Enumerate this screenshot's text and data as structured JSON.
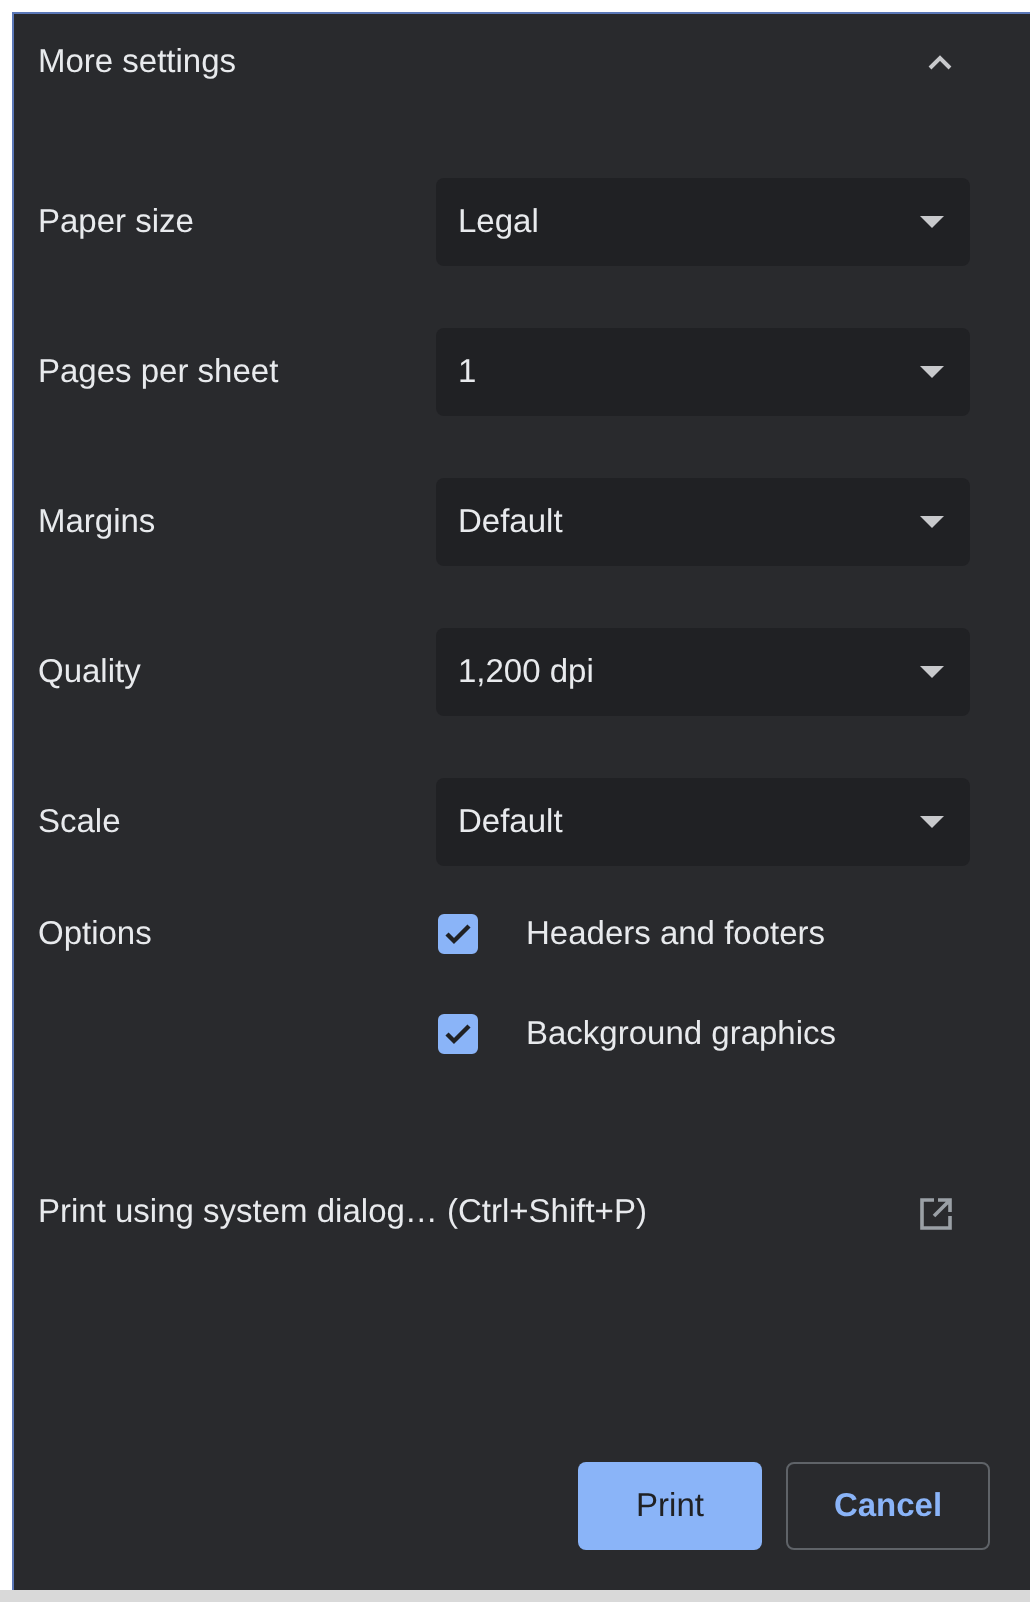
{
  "section": {
    "title": "More settings",
    "expanded": true
  },
  "settings": [
    {
      "label": "Paper size",
      "value": "Legal"
    },
    {
      "label": "Pages per sheet",
      "value": "1"
    },
    {
      "label": "Margins",
      "value": "Default"
    },
    {
      "label": "Quality",
      "value": "1,200 dpi"
    },
    {
      "label": "Scale",
      "value": "Default"
    }
  ],
  "options": {
    "label": "Options",
    "items": [
      {
        "label": "Headers and footers",
        "checked": true
      },
      {
        "label": "Background graphics",
        "checked": true
      }
    ]
  },
  "system_dialog_link": "Print using system dialog… (Ctrl+Shift+P)",
  "buttons": {
    "primary": "Print",
    "secondary": "Cancel"
  }
}
